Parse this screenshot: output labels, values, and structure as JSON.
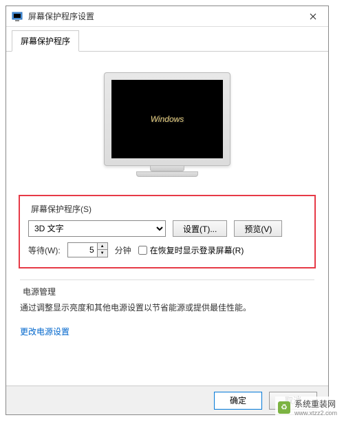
{
  "window": {
    "title": "屏幕保护程序设置"
  },
  "tab": {
    "label": "屏幕保护程序"
  },
  "preview": {
    "screensaver_text": "Windows"
  },
  "screensaver": {
    "group_label": "屏幕保护程序(S)",
    "selected": "3D 文字",
    "settings_btn": "设置(T)...",
    "preview_btn": "预览(V)",
    "wait_label": "等待(W):",
    "wait_value": "5",
    "wait_unit": "分钟",
    "resume_checkbox_label": "在恢复时显示登录屏幕(R)"
  },
  "power": {
    "group_label": "电源管理",
    "desc": "通过调整显示亮度和其他电源设置以节省能源或提供最佳性能。",
    "link": "更改电源设置"
  },
  "footer": {
    "ok": "确定",
    "cancel": "取消"
  },
  "watermark": {
    "text": "系统重装网",
    "url": "www.xtzz2.com"
  }
}
